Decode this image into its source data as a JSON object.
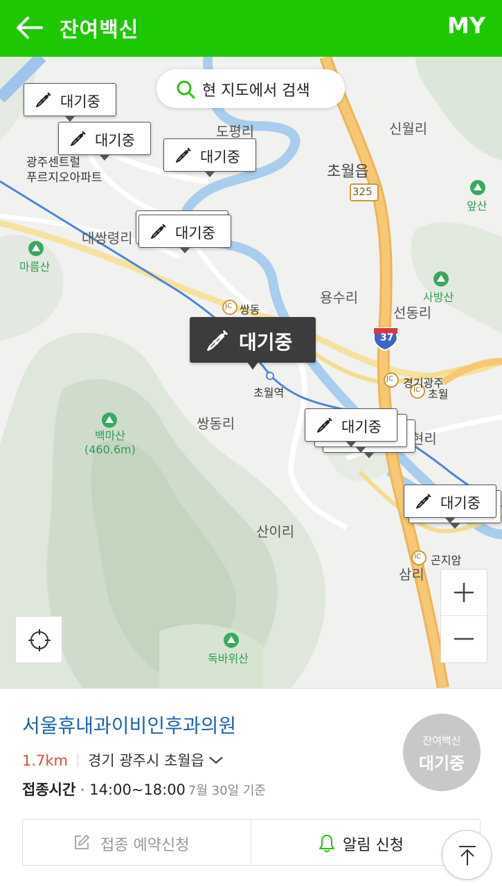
{
  "header": {
    "title": "잔여백신",
    "my_label": "MY",
    "bg_color": "#1ec800"
  },
  "map": {
    "search_label": "현 지도에서 검색",
    "marker_label": "대기중",
    "place_labels": {
      "dopyeong": "도평리",
      "sinwol": "신월리",
      "chowol": "초월읍",
      "road325": "325",
      "apt": "광주센트럴\n푸르지오아파트",
      "daessang": "대쌍령리",
      "marumsan": "마름산",
      "apsan": "앞산",
      "sabangsan": "사방산",
      "yongsu": "용수리",
      "seondong": "선동리",
      "ssangdong_jc": "쌍동",
      "road37": "37",
      "gyeonggi_jc": "경기광주",
      "chowol_ic": "초월",
      "chowol_station": "초월역",
      "ssangdongri": "쌍동리",
      "baekmasan": "백마산\n(460.6m)",
      "hyeonri": "현리",
      "sanri": "산이리",
      "samri": "삼리",
      "gonjiam_ic": "곤지암",
      "dokbawisan": "독바위산",
      "jc": "JC",
      "ic": "IC"
    }
  },
  "detail": {
    "hospital_name": "서울휴내과이비인후과의원",
    "distance": "1.7km",
    "address": "경기 광주시 초월읍",
    "time_label": "접종시간",
    "time_value": "14:00~18:00",
    "time_note": "7월 30일 기준",
    "badge_top": "잔여백신",
    "badge_bottom": "대기중",
    "reserve_label": "접종 예약신청",
    "alarm_label": "알림 신청",
    "accent_color": "#1b62b0",
    "distance_color": "#e5493a"
  }
}
